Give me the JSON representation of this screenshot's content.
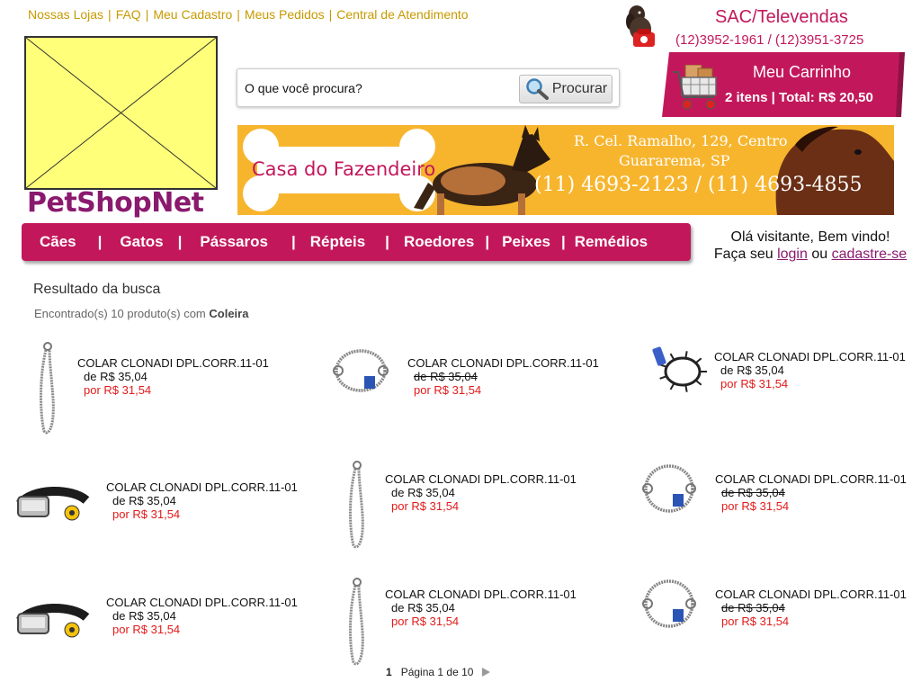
{
  "top_links": [
    "Nossas Lojas",
    "FAQ",
    "Meu Cadastro",
    "Meus Pedidos",
    "Central de Atendimento"
  ],
  "sac": {
    "title": "SAC/Televendas",
    "phones": "(12)3952-1961 / (12)3951-3725"
  },
  "brand": "PetShopNet",
  "search": {
    "label": "O que você procura?",
    "button": "Procurar"
  },
  "cart": {
    "title": "Meu Carrinho",
    "info": "2 itens | Total: R$ 20,50"
  },
  "banner": {
    "store": "Casa do Fazendeiro",
    "address1": "R. Cel. Ramalho, 129, Centro",
    "address2": "Guararema, SP",
    "phones": "(11) 4693-2123 / (11) 4693-4855"
  },
  "nav": [
    "Cães",
    "Gatos",
    "Pássaros",
    "Répteis",
    "Roedores",
    "Peixes",
    "Remédios"
  ],
  "welcome": {
    "line1": "Olá visitante, Bem vindo!",
    "prefix": "Faça seu",
    "login": "login",
    "or": "ou",
    "signup": "cadastre-se"
  },
  "results": {
    "title": "Resultado da busca",
    "found_prefix": "Encontrado(s)  10 produto(s) com",
    "query": "Coleira"
  },
  "products": [
    {
      "name": "COLAR CLONADI DPL.CORR.11-01",
      "old_price": "de R$ 35,04",
      "new_price": "por R$ 31,54",
      "old_struck": false,
      "image": "choke-chain-long-icon"
    },
    {
      "name": "COLAR CLONADI DPL.CORR.11-01",
      "old_price": "de R$ 35,04",
      "new_price": "por R$ 31,54",
      "old_struck": true,
      "image": "choke-chain-round-icon"
    },
    {
      "name": "COLAR CLONADI DPL.CORR.11-01",
      "old_price": "de R$ 35,04",
      "new_price": "por R$ 31,54",
      "old_struck": false,
      "image": "prong-collar-icon"
    },
    {
      "name": "COLAR CLONADI DPL.CORR.11-01",
      "old_price": "de R$ 35,04",
      "new_price": "por R$ 31,54",
      "old_struck": false,
      "image": "smart-collar-icon"
    },
    {
      "name": "COLAR CLONADI DPL.CORR.11-01",
      "old_price": "de R$ 35,04",
      "new_price": "por R$ 31,54",
      "old_struck": false,
      "image": "choke-chain-long-icon"
    },
    {
      "name": "COLAR CLONADI DPL.CORR.11-01",
      "old_price": "de R$ 35,04",
      "new_price": "por R$ 31,54",
      "old_struck": true,
      "image": "choke-chain-round-icon"
    },
    {
      "name": "COLAR CLONADI DPL.CORR.11-01",
      "old_price": "de R$ 35,04",
      "new_price": "por R$ 31,54",
      "old_struck": false,
      "image": "smart-collar-icon"
    },
    {
      "name": "COLAR CLONADI DPL.CORR.11-01",
      "old_price": "de R$ 35,04",
      "new_price": "por R$ 31,54",
      "old_struck": false,
      "image": "choke-chain-long-icon"
    },
    {
      "name": "COLAR CLONADI DPL.CORR.11-01",
      "old_price": "de R$ 35,04",
      "new_price": "por R$ 31,54",
      "old_struck": true,
      "image": "choke-chain-round-icon"
    }
  ],
  "pager": {
    "current": "1",
    "text": "Página 1 de 10"
  },
  "colors": {
    "accent": "#c2185b",
    "link_gold": "#c79a00",
    "price_red": "#e21a1a",
    "banner": "#f7b52e"
  }
}
